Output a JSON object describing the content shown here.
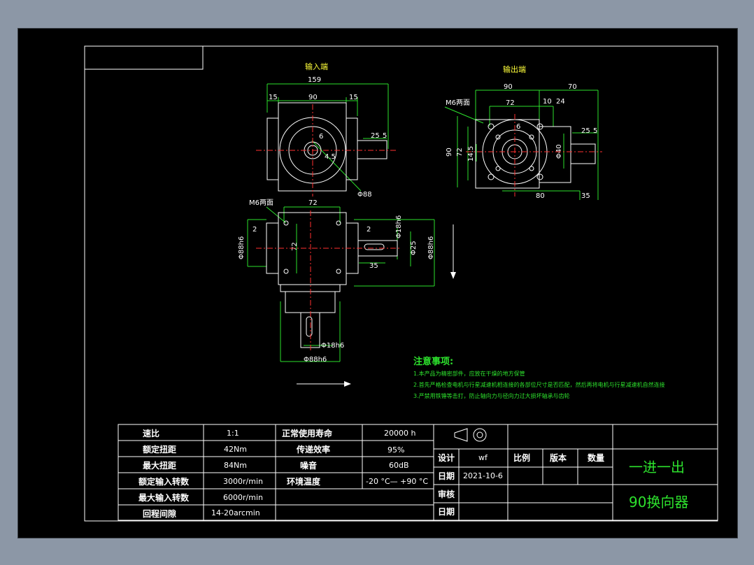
{
  "views": {
    "input_end_title": "输入端",
    "output_end_title": "输出端"
  },
  "dims": {
    "front": {
      "overall": "159",
      "left": "15",
      "mid": "90",
      "right": "15",
      "shaft_len": "25",
      "shaft_key": "5",
      "small_r": "6",
      "bore": "4.5",
      "diam": "Φ88"
    },
    "right": {
      "w_left": "90",
      "w_right": "70",
      "bolt_pitch": "72",
      "m6": "M6两面",
      "d10": "10",
      "d24": "24",
      "key": "6",
      "h90": "90",
      "h72": "72",
      "h145": "14.5",
      "dia40": "Φ40",
      "shaft25": "25",
      "shaft5": "5",
      "base80": "80",
      "base35": "35"
    },
    "lower": {
      "m6": "M6两面",
      "pitch": "72",
      "d2a": "2",
      "d2b": "2",
      "h72": "72",
      "sh1": "Φ18h6",
      "sh2": "Φ25",
      "sh3": "Φ88h6",
      "left_dia": "Φ88h6",
      "len35": "35",
      "bottom_dia": "Φ18h6",
      "bottom_flange": "Φ88h6"
    }
  },
  "notes": {
    "title": "注意事项:",
    "items": [
      "1.本产品为精密部件，应放在干燥的地方保管",
      "2.首先严格检查电机与行星减速机相连接的各部位尺寸是否匹配，然后再将电机与行星减速机自然连接",
      "3.严禁用铁锤等击打，防止轴向力与径向力过大损坏轴承与齿轮"
    ]
  },
  "specs": [
    {
      "label": "速比",
      "value": "1:1",
      "label2": "正常使用寿命",
      "value2": "20000 h"
    },
    {
      "label": "额定扭距",
      "value": "42Nm",
      "label2": "传递效率",
      "value2": "95%"
    },
    {
      "label": "最大扭距",
      "value": "84Nm",
      "label2": "噪音",
      "value2": "60dB"
    },
    {
      "label": "额定输入转数",
      "value": "3000r/min",
      "label2": "环境温度",
      "value2": "-20 °C— +90 °C"
    },
    {
      "label": "最大输入转数",
      "value": "6000r/min",
      "label2": "",
      "value2": ""
    },
    {
      "label": "回程间隙",
      "value": "14-20arcmin",
      "label2": "",
      "value2": ""
    }
  ],
  "titleblock": {
    "design_label": "设计",
    "design_value": "wf",
    "scale_label": "比例",
    "version_label": "版本",
    "qty_label": "数量",
    "date_label": "日期",
    "date_value": "2021-10-6",
    "review_label": "审核",
    "date2_label": "日期",
    "name1": "一进一出",
    "name2": "90换向器"
  },
  "colors": {
    "frame": "#ffffff",
    "dimension": "#2de12d",
    "outline": "#ffffff",
    "centerline": "#ff3030",
    "notes": "#2de12d",
    "title_name": "#2de12d"
  }
}
